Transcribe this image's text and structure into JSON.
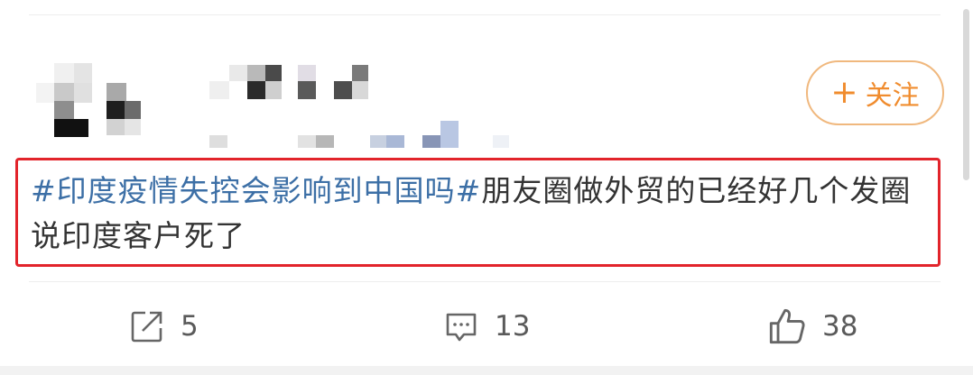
{
  "post": {
    "hashtag": "#印度疫情失控会影响到中国吗#",
    "body": "朋友圈做外贸的已经好几个发圈说印度客户死了"
  },
  "follow_button": {
    "plus": "+",
    "label": "关注"
  },
  "actions": {
    "repost": {
      "count": "5",
      "icon": "repost-icon"
    },
    "comment": {
      "count": "13",
      "icon": "comment-icon"
    },
    "like": {
      "count": "38",
      "icon": "thumbs-up-icon"
    }
  },
  "colors": {
    "accent": "#f08c2e",
    "hashtag": "#3c6fa6",
    "highlight_border": "#e2242b"
  }
}
